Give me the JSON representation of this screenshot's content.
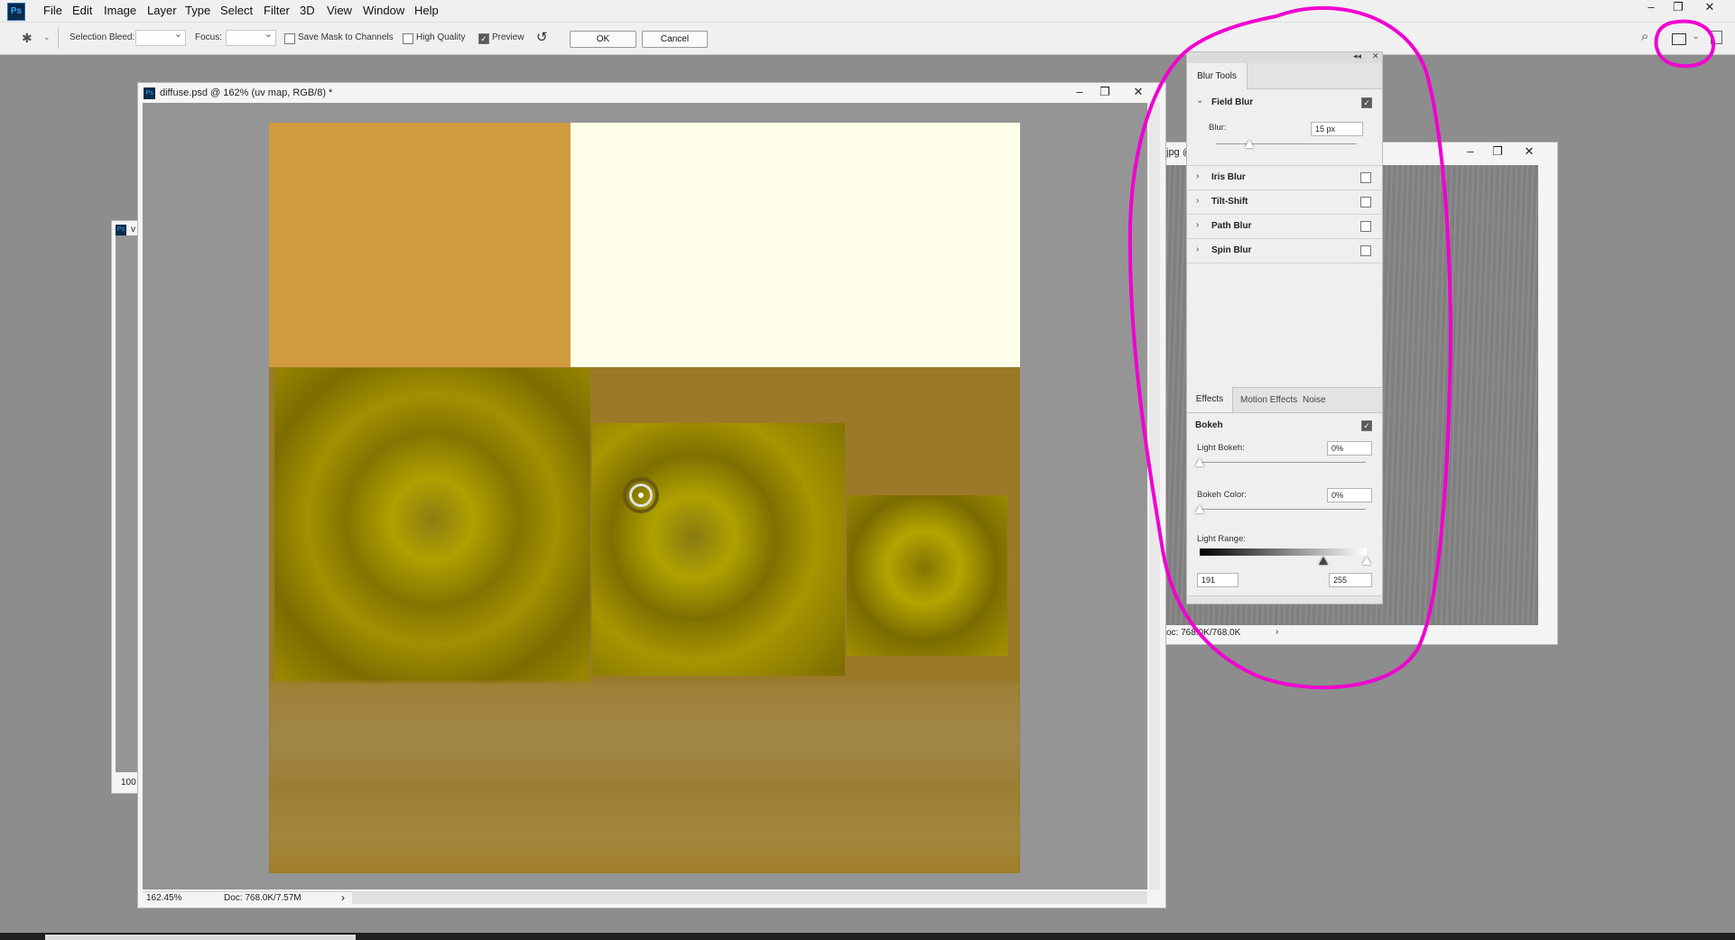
{
  "app": {
    "logo": "Ps"
  },
  "menu": [
    "File",
    "Edit",
    "Image",
    "Layer",
    "Type",
    "Select",
    "Filter",
    "3D",
    "View",
    "Window",
    "Help"
  ],
  "window_controls": {
    "minimize": "–",
    "restore": "❐",
    "close": "✕"
  },
  "options_bar": {
    "selection_bleed_label": "Selection Bleed:",
    "focus_label": "Focus:",
    "save_mask_label": "Save Mask to Channels",
    "save_mask_checked": false,
    "high_quality_label": "High Quality",
    "high_quality_checked": false,
    "preview_label": "Preview",
    "preview_checked": true,
    "ok_label": "OK",
    "cancel_label": "Cancel"
  },
  "doc_main": {
    "title": "diffuse.psd @ 162% (uv map, RGB/8) *",
    "zoom": "162.45%",
    "doc_info": "Doc: 768.0K/7.57M",
    "colors": {
      "orange": "#d19c3f",
      "cream": "#fffee8",
      "olive": "#9a7a29",
      "gold": "#a69500"
    }
  },
  "doc_left": {
    "title_fragment": "v",
    "zoom_fragment": "100"
  },
  "doc_right": {
    "title_fragment": "jpg @",
    "doc_info_fragment": "oc: 768.0K/768.0K"
  },
  "blur_panel": {
    "tab": "Blur Tools",
    "field_blur": {
      "label": "Field Blur",
      "checked": true,
      "blur_label": "Blur:",
      "blur_value": "15 px"
    },
    "others": [
      {
        "label": "Iris Blur",
        "checked": false
      },
      {
        "label": "Tilt-Shift",
        "checked": false
      },
      {
        "label": "Path Blur",
        "checked": false
      },
      {
        "label": "Spin Blur",
        "checked": false
      }
    ]
  },
  "effects_panel": {
    "tabs": [
      "Effects",
      "Motion Effects",
      "Noise"
    ],
    "bokeh_label": "Bokeh",
    "bokeh_checked": true,
    "light_bokeh_label": "Light Bokeh:",
    "light_bokeh_value": "0%",
    "bokeh_color_label": "Bokeh Color:",
    "bokeh_color_value": "0%",
    "light_range_label": "Light Range:",
    "light_range_low": "191",
    "light_range_high": "255"
  },
  "annotation": {
    "color": "#f000d0"
  }
}
